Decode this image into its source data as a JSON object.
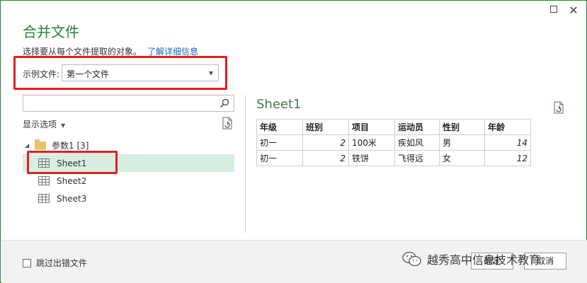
{
  "dialog": {
    "title": "合并文件",
    "instruction": "选择要从每个文件提取的对象。",
    "learn_more": "了解详细信息"
  },
  "sample": {
    "label": "示例文件:",
    "selected": "第一个文件"
  },
  "navigator": {
    "display_options": "显示选项",
    "folder": "参数1 [3]",
    "items": [
      {
        "label": "Sheet1",
        "selected": true
      },
      {
        "label": "Sheet2",
        "selected": false
      },
      {
        "label": "Sheet3",
        "selected": false
      }
    ]
  },
  "preview": {
    "title": "Sheet1",
    "headers": [
      "年级",
      "班别",
      "项目",
      "运动员",
      "性别",
      "年龄"
    ],
    "rows": [
      [
        "初一",
        "2",
        "100米",
        "疾如风",
        "男",
        "14"
      ],
      [
        "初一",
        "2",
        "铁饼",
        "飞得远",
        "女",
        "12"
      ]
    ]
  },
  "footer": {
    "skip_errors": "跳过出错文件",
    "ok_label": "确定",
    "cancel_label": "取消"
  },
  "watermark": {
    "text": "越秀高中信息技术教育"
  },
  "colors": {
    "accent": "#2e7d32",
    "highlight": "#e02020",
    "selected_bg": "#d6efe0",
    "link": "#1565c0"
  }
}
